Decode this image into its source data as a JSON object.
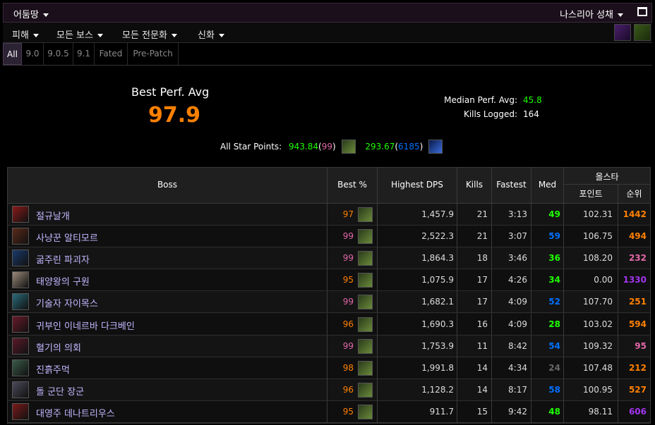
{
  "titlebar": {
    "character": "어둠땅",
    "server": "나스리아 성채"
  },
  "menu": {
    "items": [
      "피해",
      "모든 보스",
      "모든 전문화",
      "신화"
    ]
  },
  "tabs": [
    "All",
    "9.0",
    "9.0.5",
    "9.1",
    "Fated",
    "Pre-Patch"
  ],
  "summary": {
    "best_perf_label": "Best Perf. Avg",
    "best_perf_value": "97.9",
    "median_label": "Median Perf. Avg:",
    "median_value": "45.8",
    "kills_label": "Kills Logged:",
    "kills_value": "164",
    "star_label": "All Star Points:",
    "star_points_1": "943.84",
    "star_rank_1": "99",
    "star_points_2": "293.67",
    "star_rank_2": "6185"
  },
  "table": {
    "headers": {
      "boss": "Boss",
      "best": "Best %",
      "dps": "Highest DPS",
      "kills": "Kills",
      "fastest": "Fastest",
      "med": "Med",
      "allstar": "올스타",
      "points": "포인트",
      "rank": "순위"
    },
    "rows": [
      {
        "name": "절규날개",
        "best": "97",
        "best_color": "#ff8000",
        "dps": "1,457.9",
        "kills": "21",
        "fastest": "3:13",
        "med": "49",
        "med_color": "#1eff00",
        "points": "102.31",
        "rank": "1442",
        "rank_color": "#ff8000",
        "icon_color": "#8a1a1a"
      },
      {
        "name": "사냥꾼 알티모르",
        "best": "99",
        "best_color": "#e268a8",
        "dps": "2,522.3",
        "kills": "21",
        "fastest": "3:07",
        "med": "59",
        "med_color": "#0070ff",
        "points": "106.75",
        "rank": "494",
        "rank_color": "#ff8000",
        "icon_color": "#5a2a1a"
      },
      {
        "name": "굶주린 파괴자",
        "best": "99",
        "best_color": "#e268a8",
        "dps": "1,864.3",
        "kills": "18",
        "fastest": "3:46",
        "med": "36",
        "med_color": "#1eff00",
        "points": "108.20",
        "rank": "232",
        "rank_color": "#e268a8",
        "icon_color": "#1a3a6a"
      },
      {
        "name": "태양왕의 구원",
        "best": "95",
        "best_color": "#ff8000",
        "dps": "1,075.9",
        "kills": "17",
        "fastest": "4:26",
        "med": "34",
        "med_color": "#1eff00",
        "points": "0.00",
        "rank": "1330",
        "rank_color": "#a335ee",
        "icon_color": "#9a8a7a"
      },
      {
        "name": "기술자 자이목스",
        "best": "99",
        "best_color": "#e268a8",
        "dps": "1,682.1",
        "kills": "17",
        "fastest": "4:09",
        "med": "52",
        "med_color": "#0070ff",
        "points": "107.70",
        "rank": "251",
        "rank_color": "#ff8000",
        "icon_color": "#2a6a7a"
      },
      {
        "name": "귀부인 이네르바 다크베인",
        "best": "96",
        "best_color": "#ff8000",
        "dps": "1,690.3",
        "kills": "16",
        "fastest": "4:09",
        "med": "28",
        "med_color": "#1eff00",
        "points": "103.02",
        "rank": "594",
        "rank_color": "#ff8000",
        "icon_color": "#6a1a2a"
      },
      {
        "name": "혈기의 의회",
        "best": "99",
        "best_color": "#e268a8",
        "dps": "1,753.9",
        "kills": "11",
        "fastest": "8:42",
        "med": "54",
        "med_color": "#0070ff",
        "points": "109.32",
        "rank": "95",
        "rank_color": "#e268a8",
        "icon_color": "#5a1a2a"
      },
      {
        "name": "진흙주먹",
        "best": "98",
        "best_color": "#ff8000",
        "dps": "1,991.8",
        "kills": "14",
        "fastest": "4:34",
        "med": "24",
        "med_color": "#666666",
        "points": "107.48",
        "rank": "212",
        "rank_color": "#ff8000",
        "icon_color": "#3a5a4a"
      },
      {
        "name": "돌 군단 장군",
        "best": "96",
        "best_color": "#ff8000",
        "dps": "1,128.2",
        "kills": "14",
        "fastest": "8:17",
        "med": "58",
        "med_color": "#0070ff",
        "points": "100.95",
        "rank": "527",
        "rank_color": "#ff8000",
        "icon_color": "#4a4a5a"
      },
      {
        "name": "대영주 데나트리우스",
        "best": "95",
        "best_color": "#ff8000",
        "dps": "911.7",
        "kills": "15",
        "fastest": "9:42",
        "med": "48",
        "med_color": "#1eff00",
        "points": "98.11",
        "rank": "606",
        "rank_color": "#a335ee",
        "icon_color": "#7a1a1a"
      }
    ]
  }
}
